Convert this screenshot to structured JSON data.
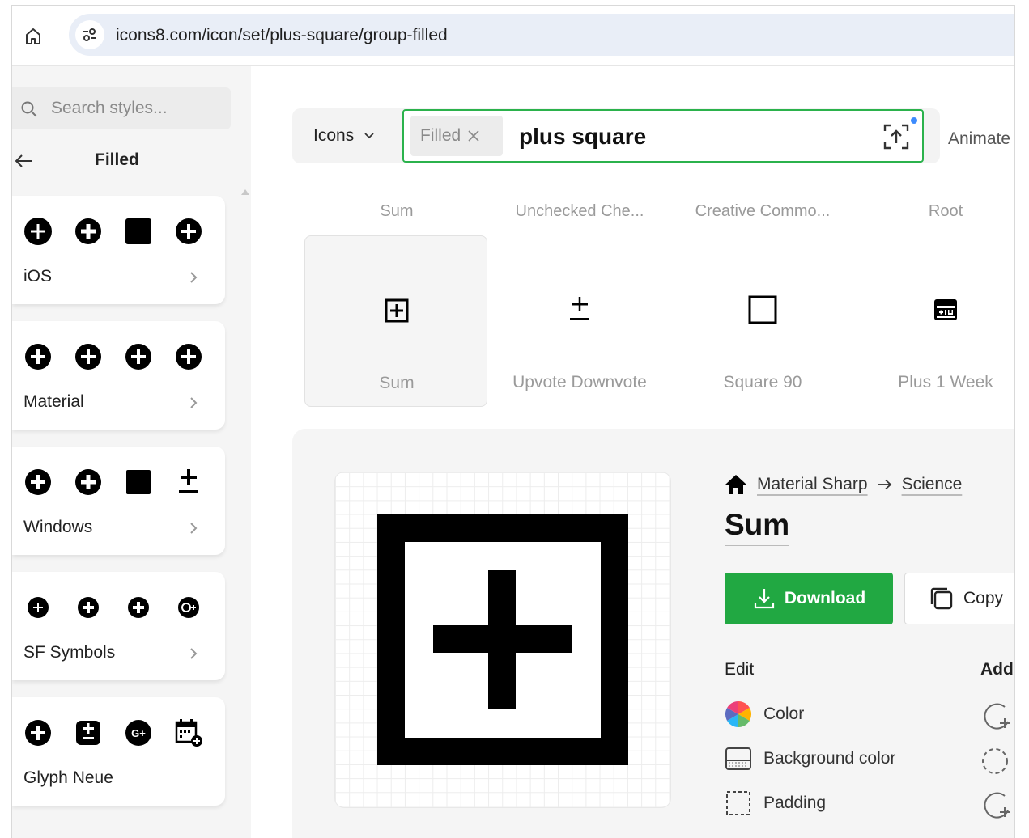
{
  "browser": {
    "url": "icons8.com/icon/set/plus-square/group-filled"
  },
  "sidebar": {
    "search_placeholder": "Search styles...",
    "current_style": "Filled",
    "styles": [
      {
        "label": "iOS",
        "icons": [
          "plus-circle-icon",
          "plus-circle-icon",
          "filled-square-icon",
          "plus-circle-icon"
        ]
      },
      {
        "label": "Material",
        "icons": [
          "plus-circle-icon",
          "plus-circle-icon",
          "plus-circle-icon",
          "plus-circle-icon"
        ]
      },
      {
        "label": "Windows",
        "icons": [
          "plus-circle-icon",
          "plus-circle-icon",
          "filled-square-icon",
          "plus-minus-icon"
        ]
      },
      {
        "label": "SF Symbols",
        "icons": [
          "plus-circle-icon",
          "plus-circle-icon",
          "plus-circle-icon",
          "google-plus-icon"
        ]
      },
      {
        "label": "Glyph Neue",
        "icons": [
          "plus-circle-icon",
          "plus-minus-box-icon",
          "google-plus-icon",
          "calendar-plus-icon"
        ]
      }
    ]
  },
  "search": {
    "type_label": "Icons",
    "filter_chip": "Filled",
    "query": "plus square",
    "animated_label": "Animate"
  },
  "related": [
    "Sum",
    "Unchecked Che...",
    "Creative Commo...",
    "Root"
  ],
  "results": [
    {
      "label": "Sum",
      "icon": "plus-box-icon",
      "selected": true
    },
    {
      "label": "Upvote Downvote",
      "icon": "plus-minus-icon",
      "selected": false
    },
    {
      "label": "Square 90",
      "icon": "square-outline-icon",
      "selected": false
    },
    {
      "label": "Plus 1 Week",
      "icon": "calendar-plus-week-icon",
      "selected": false
    }
  ],
  "detail": {
    "breadcrumb": [
      "Material Sharp",
      "Science"
    ],
    "title": "Sum",
    "download_label": "Download",
    "copy_label": "Copy",
    "edit_heading": "Edit",
    "add_heading": "Add",
    "edit_options": [
      "Color",
      "Background color",
      "Padding"
    ],
    "colors": {
      "download": "#21a842",
      "search_border": "#2bb24c"
    }
  }
}
